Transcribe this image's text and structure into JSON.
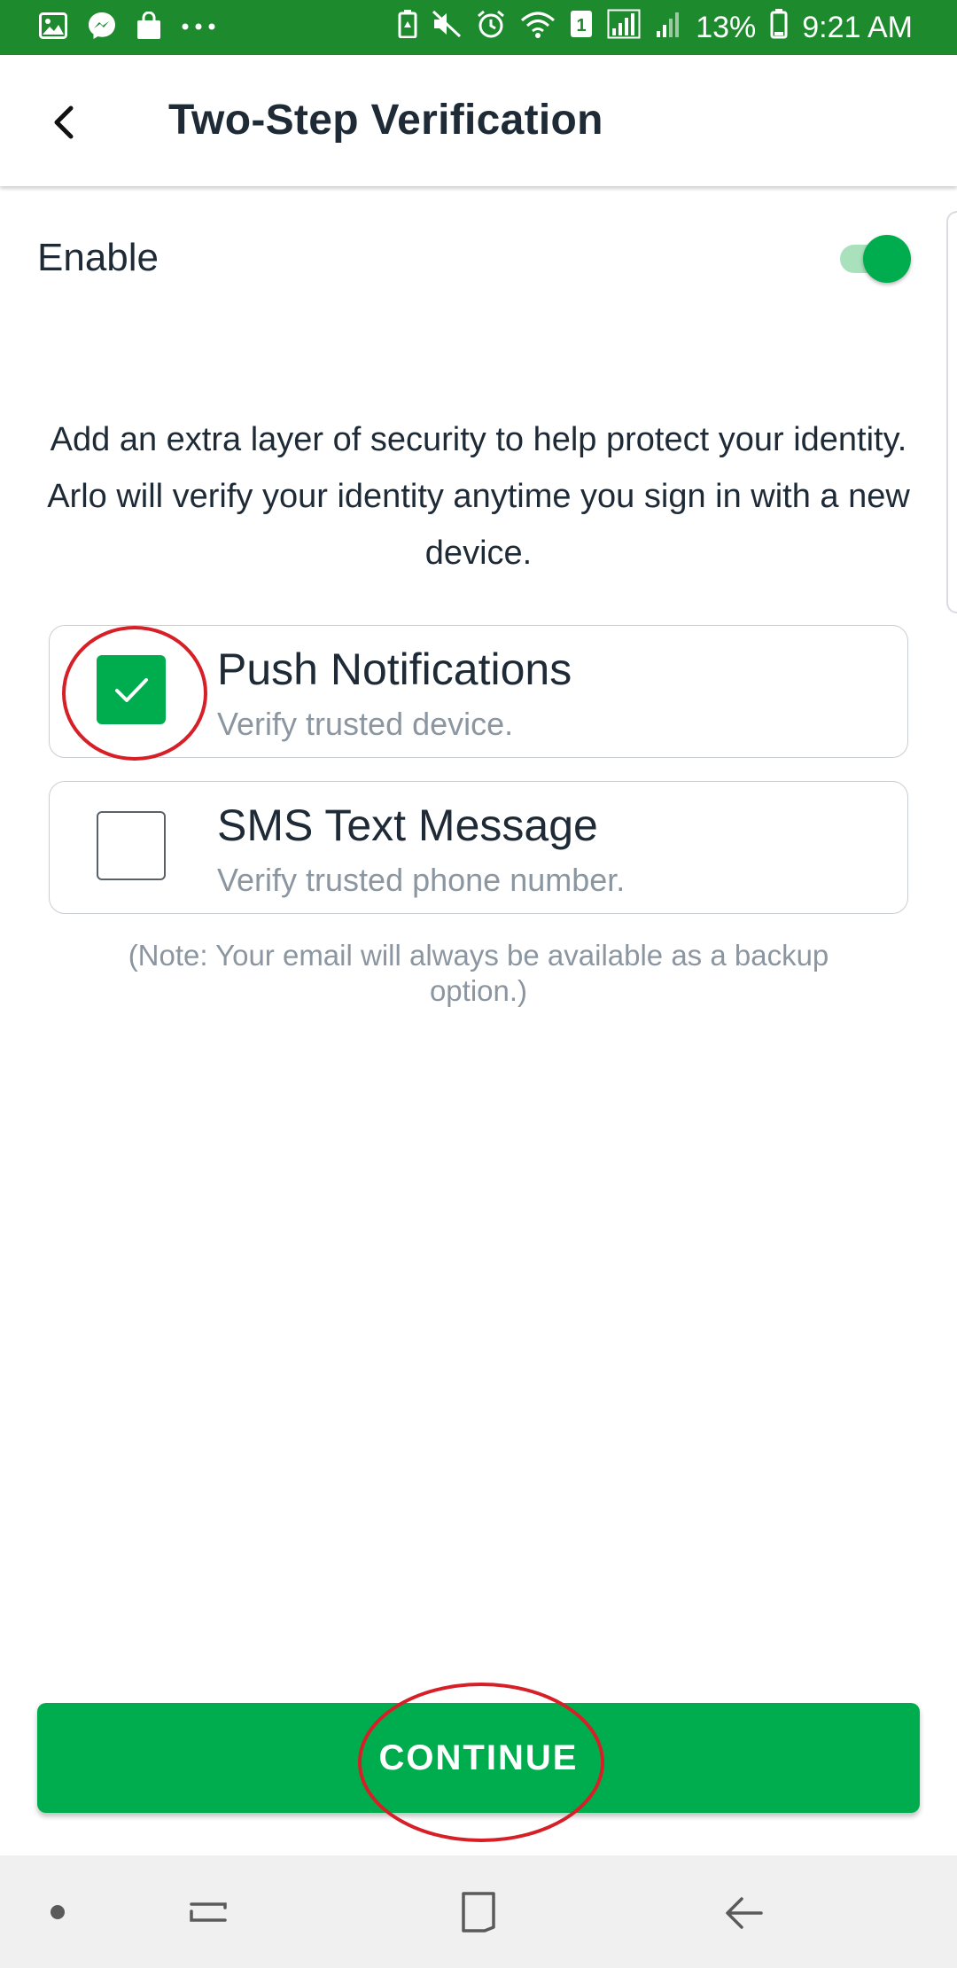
{
  "status_bar": {
    "left_icons": [
      "gallery-icon",
      "messenger-icon",
      "shopping-bag-icon",
      "more-dots-icon"
    ],
    "right_icons": [
      "battery-saver-icon",
      "mute-icon",
      "alarm-icon",
      "wifi-icon",
      "sim-1-icon",
      "signal-icon",
      "signal-2-icon"
    ],
    "sim_label": "1",
    "battery_percent": "13%",
    "time": "9:21 AM",
    "color": "#1e8a2e"
  },
  "header": {
    "back_icon": "chevron-left-icon",
    "title": "Two-Step Verification"
  },
  "enable": {
    "label": "Enable",
    "toggle_on": true,
    "accent": "#00ad4e"
  },
  "description": "Add an extra layer of security to help protect your identity. Arlo will verify your identity anytime you sign in with a new device.",
  "options": [
    {
      "title": "Push Notifications",
      "subtitle": "Verify trusted device.",
      "checked": true
    },
    {
      "title": "SMS Text Message",
      "subtitle": "Verify trusted phone number.",
      "checked": false
    }
  ],
  "note": "(Note: Your email will always be available as a backup option.)",
  "continue_label": "CONTINUE",
  "nav_bar": {
    "icons": [
      "dot-icon",
      "recents-icon",
      "home-icon",
      "back-arrow-icon"
    ]
  },
  "annotation_color": "#d61f26"
}
